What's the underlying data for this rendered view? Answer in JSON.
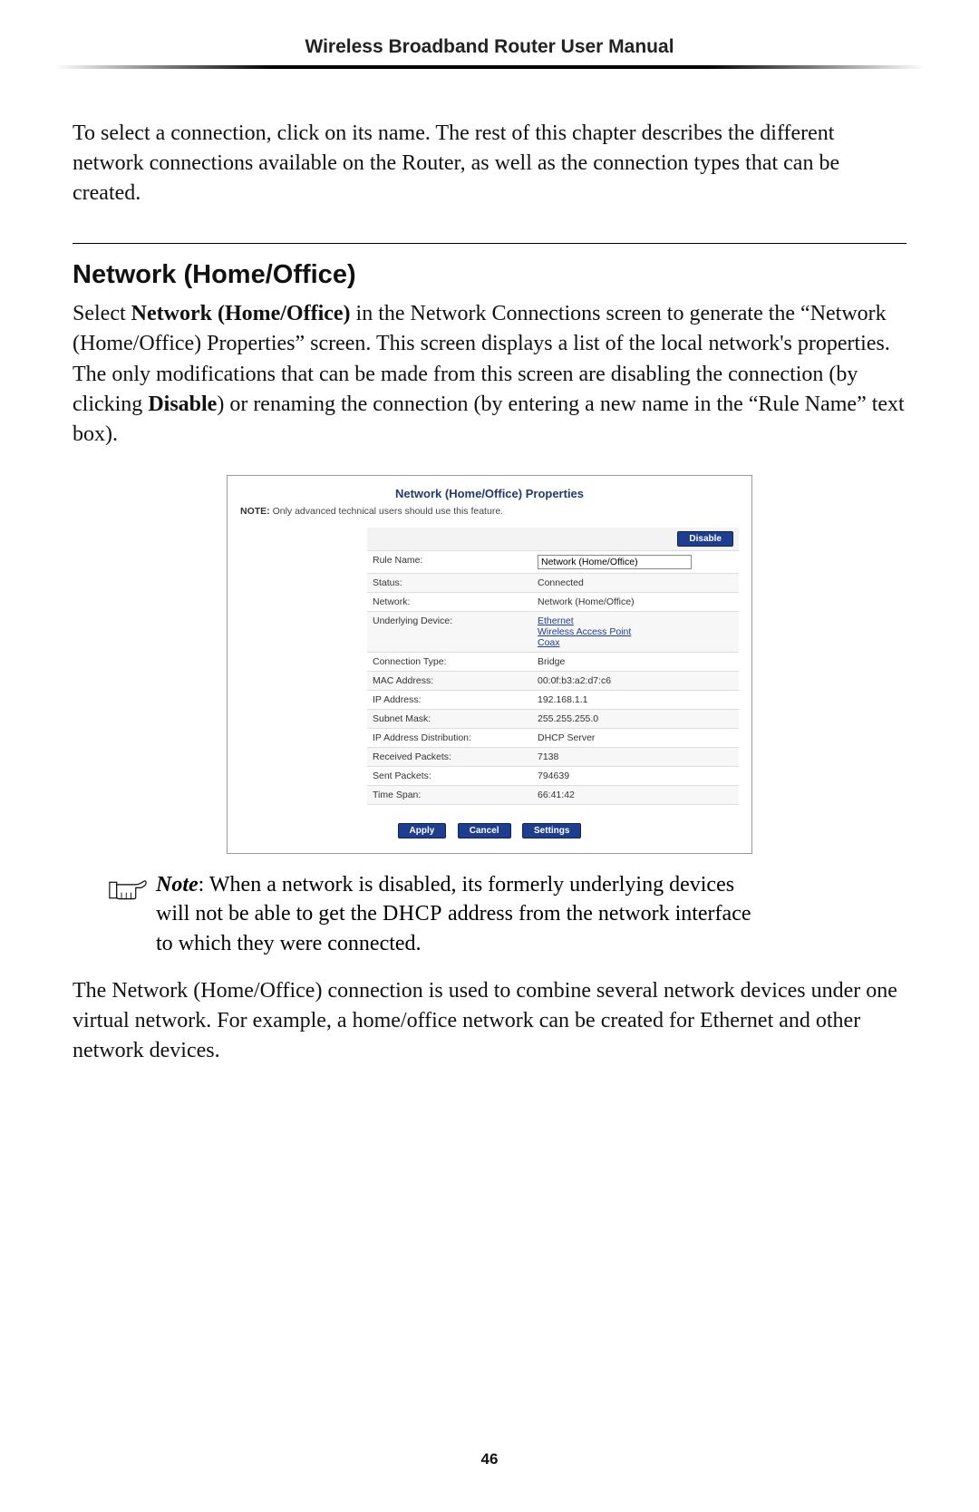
{
  "header": {
    "title": "Wireless Broadband Router User Manual"
  },
  "intro_para": "To select a connection, click on its name. The rest of this chapter describes the different network connections available on the Router, as well as the connection types that can be created.",
  "section": {
    "heading": "Network (Home/Office)",
    "para1_a": "Select ",
    "para1_b": "Network (Home/Office)",
    "para1_c": " in the Network Connections screen to generate the “Network (Home/Office) Properties” screen. This screen displays a list of the local network's properties. The only modifications that can be made from this screen are disabling the connection (by clicking ",
    "para1_d": "Disable",
    "para1_e": ") or renaming the connection (by entering a new name in the “Rule Name” text box)."
  },
  "ui": {
    "title": "Network (Home/Office) Properties",
    "note_label": "NOTE:",
    "note_text": " Only advanced technical users should use this feature.",
    "disable_btn": "Disable",
    "rule_name_label": "Rule Name:",
    "rule_name_value": "Network (Home/Office)",
    "rows": [
      {
        "label": "Status:",
        "value": "Connected",
        "style": "green"
      },
      {
        "label": "Network:",
        "value": "Network (Home/Office)"
      },
      {
        "label": "Underlying Device:",
        "value_lines": [
          "Ethernet",
          "Wireless Access Point",
          "Coax"
        ],
        "style": "link"
      },
      {
        "label": "Connection Type:",
        "value": "Bridge"
      },
      {
        "label": "MAC Address:",
        "value": "00:0f:b3:a2:d7:c6"
      },
      {
        "label": "IP Address:",
        "value": "192.168.1.1"
      },
      {
        "label": "Subnet Mask:",
        "value": "255.255.255.0"
      },
      {
        "label": "IP Address Distribution:",
        "value": "DHCP Server"
      },
      {
        "label": "Received Packets:",
        "value": "7138"
      },
      {
        "label": "Sent Packets:",
        "value": "794639"
      },
      {
        "label": "Time Span:",
        "value": "66:41:42"
      }
    ],
    "footer_buttons": {
      "apply": "Apply",
      "cancel": "Cancel",
      "settings": "Settings"
    }
  },
  "note": {
    "prefix": "Note",
    "body_a": ": When a network is disabled, its formerly underlying devices will not be able to get the ",
    "dhcp": "DHCP",
    "body_b": " address from the network interface to which they were connected."
  },
  "closing_para": "The Network (Home/Office) connection is used to combine several network devices under one virtual network. For example, a home/office network can be created for Ethernet and other network devices.",
  "page_number": "46"
}
